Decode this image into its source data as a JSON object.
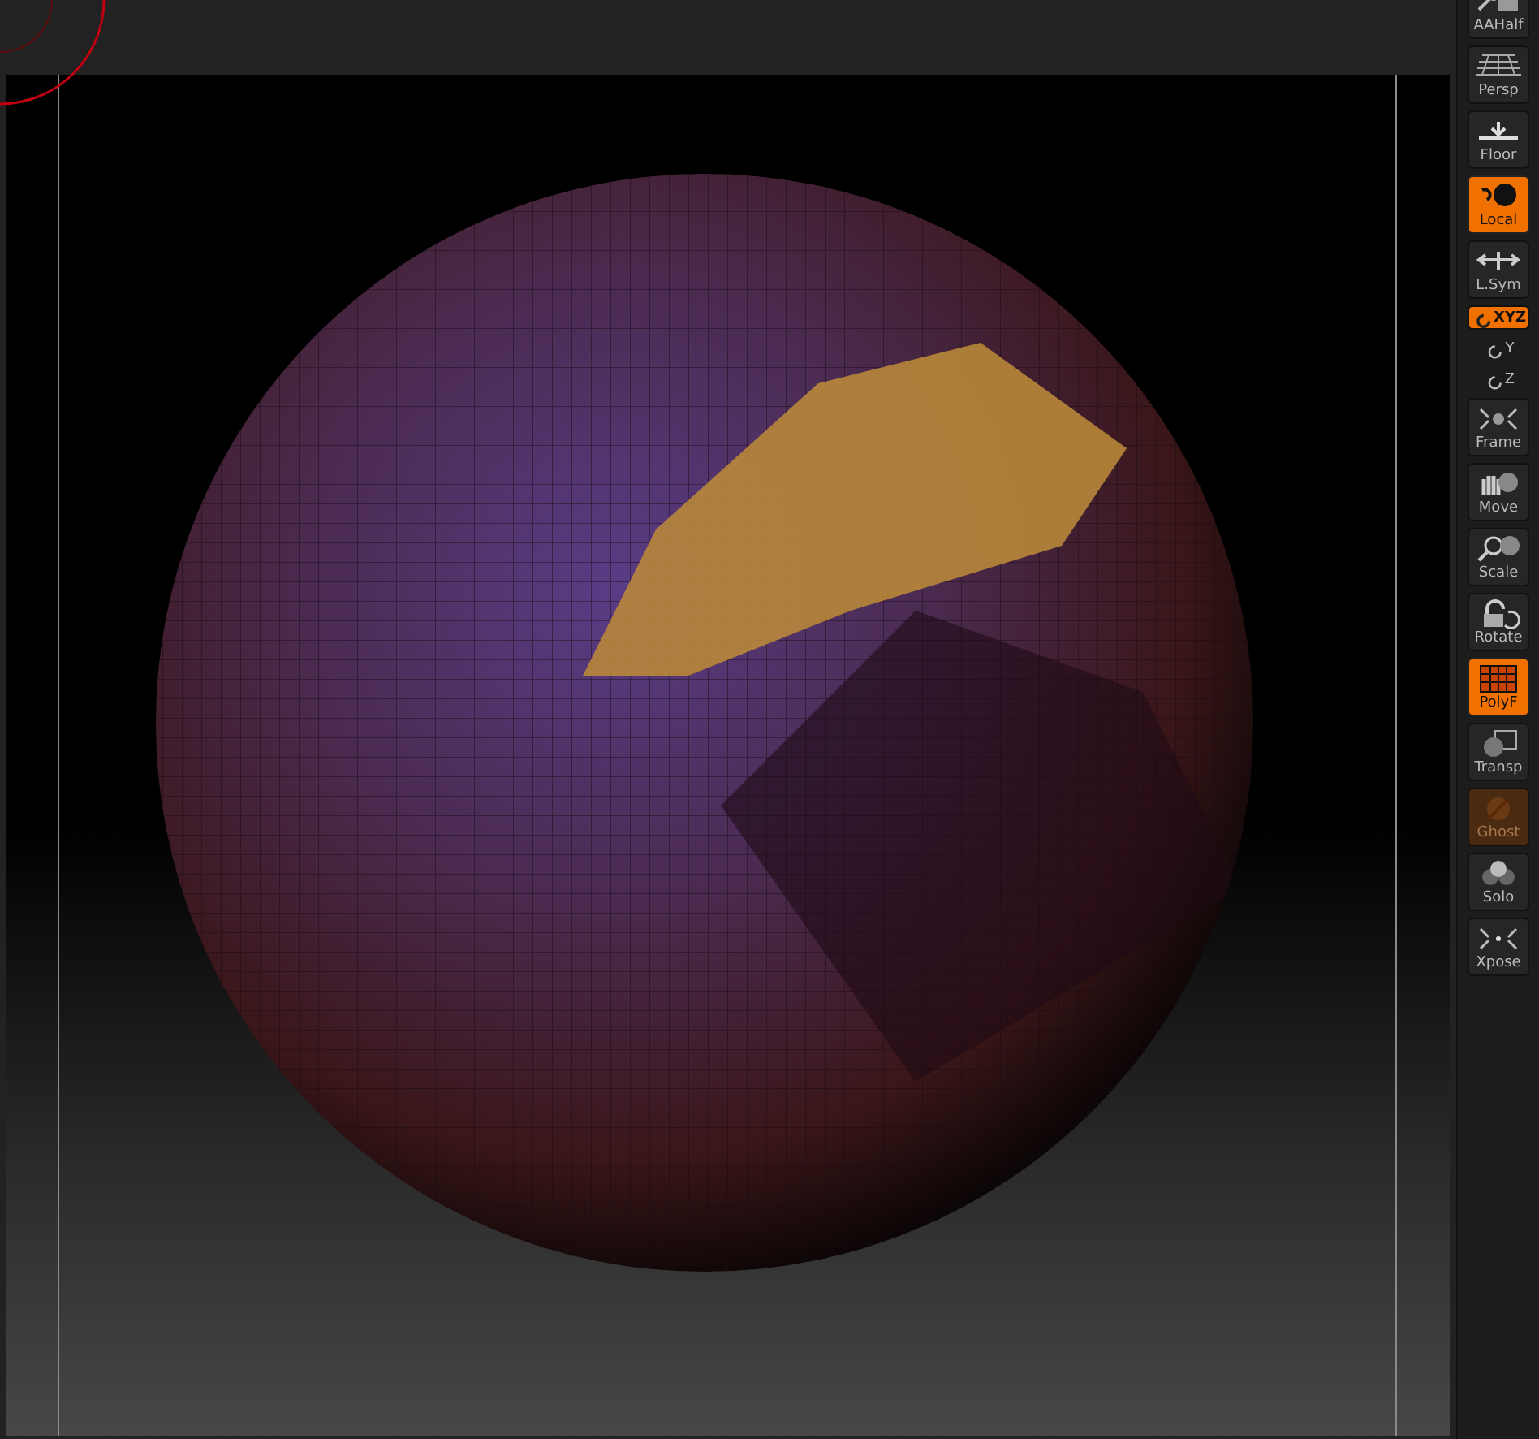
{
  "viewport": {
    "toolbar": {
      "buttons": [
        {
          "label": "AAHalf",
          "kind": "button",
          "on": false,
          "disabled": false
        },
        {
          "label": "Persp",
          "kind": "button",
          "on": false,
          "disabled": false
        },
        {
          "label": "Floor",
          "kind": "button",
          "on": false,
          "disabled": false
        },
        {
          "label": "Local",
          "kind": "button",
          "on": true,
          "disabled": false
        },
        {
          "label": "L.Sym",
          "kind": "button",
          "on": false,
          "disabled": false
        },
        {
          "label": "XYZ",
          "kind": "small",
          "on": true,
          "disabled": false
        },
        {
          "label": "Y",
          "kind": "small",
          "on": false,
          "disabled": false
        },
        {
          "label": "Z",
          "kind": "small",
          "on": false,
          "disabled": false
        },
        {
          "label": "Frame",
          "kind": "button",
          "on": false,
          "disabled": false
        },
        {
          "label": "Move",
          "kind": "button",
          "on": false,
          "disabled": false
        },
        {
          "label": "Scale",
          "kind": "button",
          "on": false,
          "disabled": false
        },
        {
          "label": "Rotate",
          "kind": "button",
          "on": false,
          "disabled": false
        },
        {
          "label": "PolyF",
          "kind": "button",
          "on": true,
          "disabled": false
        },
        {
          "label": "Transp",
          "kind": "button",
          "on": false,
          "disabled": false
        },
        {
          "label": "Ghost",
          "kind": "button",
          "on": false,
          "disabled": true
        },
        {
          "label": "Solo",
          "kind": "button",
          "on": false,
          "disabled": false
        },
        {
          "label": "Xpose",
          "kind": "button",
          "on": false,
          "disabled": false
        }
      ]
    }
  }
}
